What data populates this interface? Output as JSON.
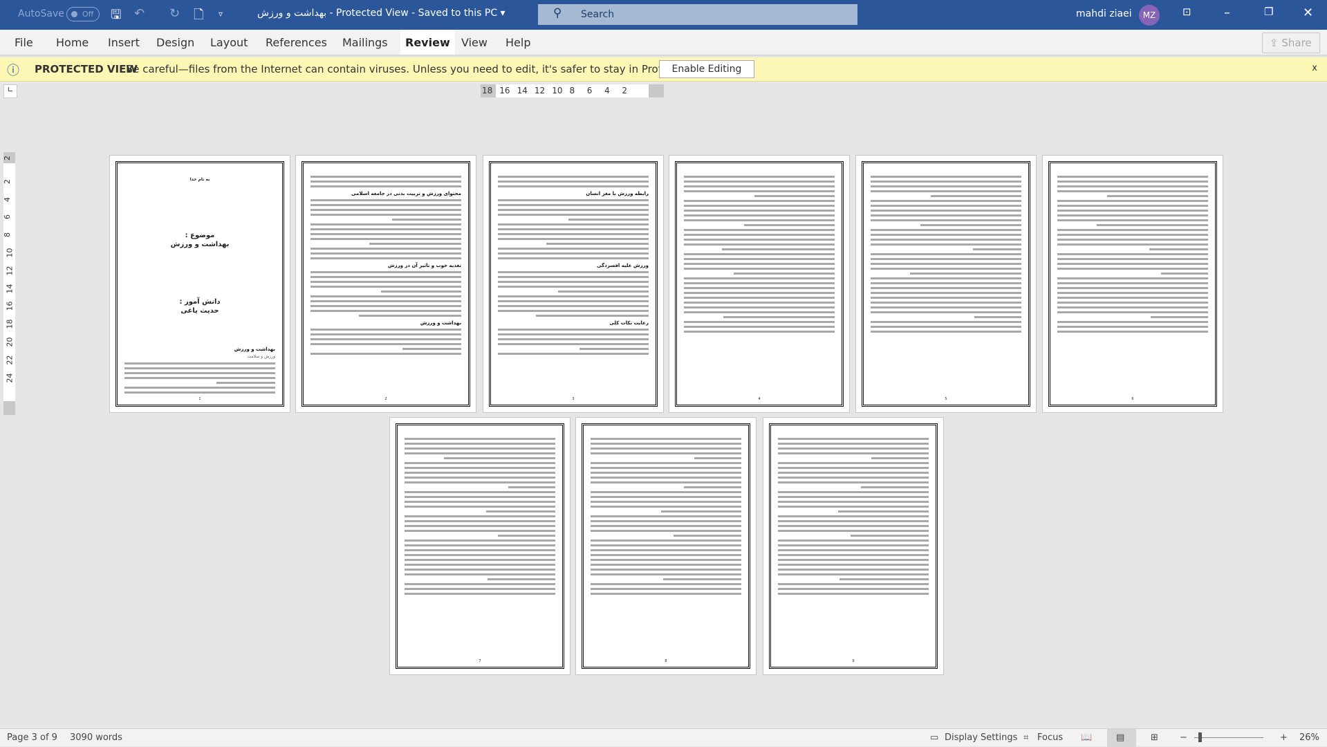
{
  "titlebar": {
    "autosave_label": "AutoSave",
    "autosave_state": "Off",
    "document_title": "بهداشت و ورزش  -  Protected View  -  Saved to this PC  ▾",
    "search_placeholder": "Search",
    "user_name": "mahdi ziaei",
    "user_initials": "MZ",
    "icons": [
      "save-icon",
      "undo-icon",
      "redo-icon",
      "new-document-icon",
      "customize-toolbar-icon",
      "ribbon-display-icon",
      "minimize-icon",
      "restore-icon",
      "close-icon"
    ]
  },
  "ribbon": {
    "tabs": [
      "File",
      "Home",
      "Insert",
      "Design",
      "Layout",
      "References",
      "Mailings",
      "Review",
      "View",
      "Help"
    ],
    "active_tab": "Review",
    "share_label": "Share"
  },
  "protected_view": {
    "label": "PROTECTED VIEW",
    "message": "Be careful—files from the Internet can contain viruses. Unless you need to edit, it's safer to stay in Protected View.",
    "enable_button": "Enable Editing",
    "close": "x"
  },
  "rulers": {
    "horizontal": [
      "18",
      "16",
      "14",
      "12",
      "10",
      "8",
      "6",
      "4",
      "2"
    ],
    "vertical": [
      "2",
      "2",
      "4",
      "6",
      "8",
      "10",
      "12",
      "14",
      "16",
      "18",
      "20",
      "22",
      "24"
    ]
  },
  "pages": [
    {
      "number": "1",
      "cover": {
        "top": "به نام خدا",
        "subject_label": "موضوع :",
        "subject": "بهداشت و ورزش",
        "student_label": "دانش آموز :",
        "student": "حدیث یاغی",
        "heading": "بهداشت و ورزش",
        "subheading": "ورزش و سلامت"
      }
    },
    {
      "number": "2",
      "headings": [
        "محتوای ورزش و تربیت بدنی در جامعه اسلامی",
        "تغذیه خوب و تاثیر آن در ورزش",
        "بهداشت و ورزش"
      ]
    },
    {
      "number": "3",
      "headings": [
        "رابطه ورزش با مغز انسان",
        "ورزش علیه افسردگی",
        "رعایت نکات کلی"
      ]
    },
    {
      "number": "4",
      "headings": []
    },
    {
      "number": "5",
      "headings": []
    },
    {
      "number": "6",
      "headings": []
    },
    {
      "number": "7",
      "headings": []
    },
    {
      "number": "8",
      "headings": []
    },
    {
      "number": "9",
      "headings": []
    }
  ],
  "statusbar": {
    "page_info": "Page 3 of 9",
    "word_count": "3090 words",
    "display_settings": "Display Settings",
    "focus": "Focus",
    "zoom_minus": "−",
    "zoom_plus": "+",
    "zoom_level": "26%",
    "zoom_percent": 26,
    "active_view": "print-layout"
  }
}
